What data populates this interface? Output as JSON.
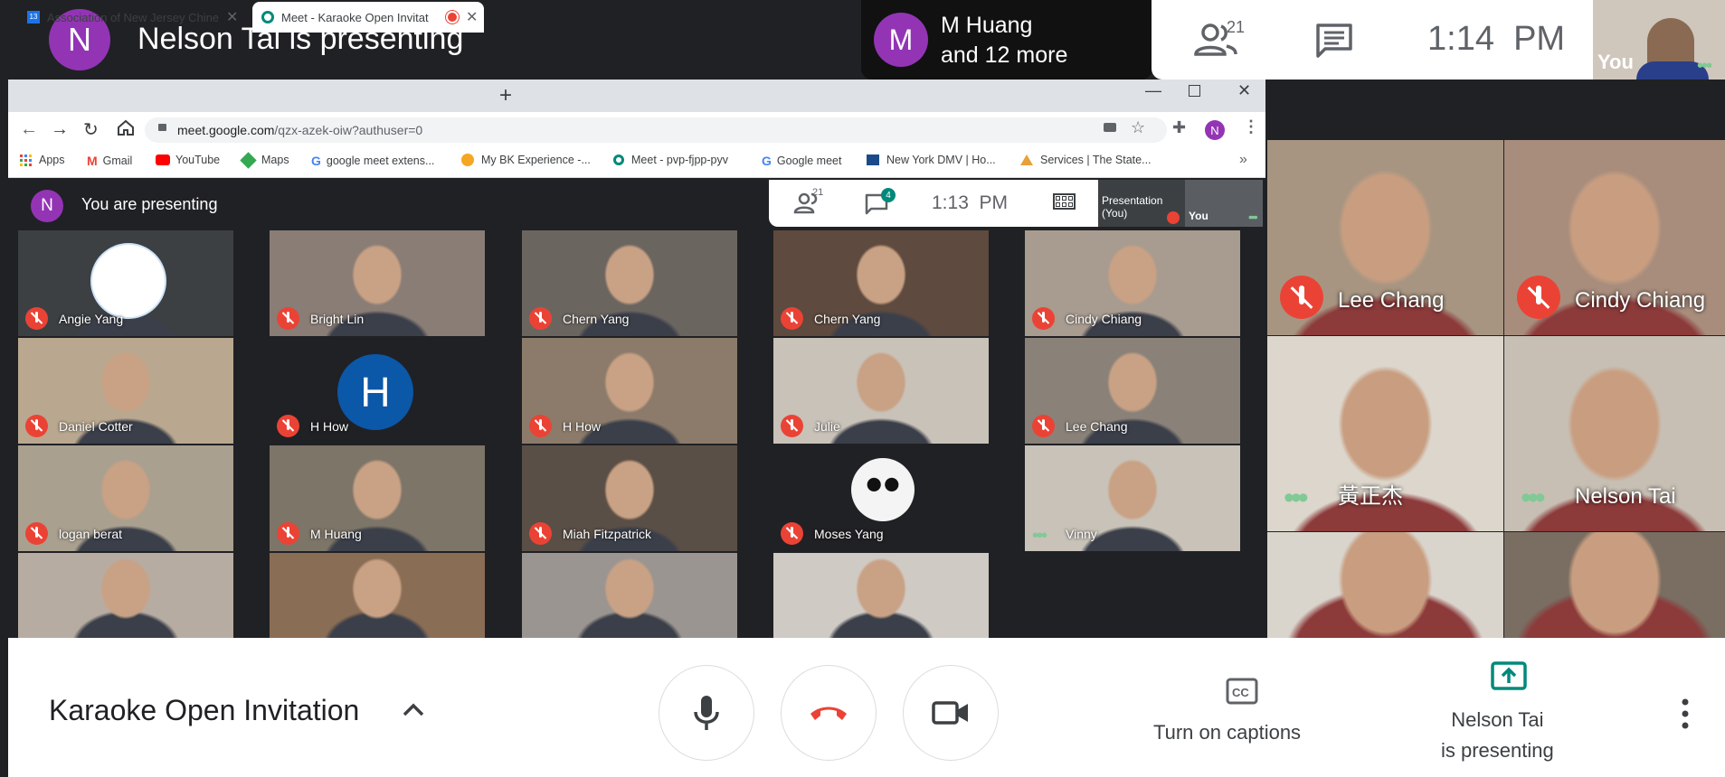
{
  "top_bar": {
    "presenter_initial": "N",
    "presenting_text": "Nelson Tai is presenting",
    "others_initial": "M",
    "others_line1": "M Huang",
    "others_line2": "and 12 more",
    "people_count": "21",
    "clock": "1:14  PM",
    "self_label": "You"
  },
  "browser": {
    "tabs": [
      {
        "label": "Association of New Jersey Chine",
        "icon": "calendar-icon"
      },
      {
        "label": "Meet - Karaoke Open Invitat",
        "icon": "meet-icon",
        "recording": true
      }
    ],
    "url_prefix": "meet.google.com",
    "url_rest": "/qzx-azek-oiw?authuser=0",
    "profile_initial": "N",
    "bookmarks": [
      {
        "label": "Apps",
        "icon": "apps-grid-icon"
      },
      {
        "label": "Gmail",
        "icon": "gmail-icon"
      },
      {
        "label": "YouTube",
        "icon": "youtube-icon"
      },
      {
        "label": "Maps",
        "icon": "maps-icon"
      },
      {
        "label": "google meet extens...",
        "icon": "google-icon"
      },
      {
        "label": "My BK Experience -...",
        "icon": "bk-icon"
      },
      {
        "label": "Meet - pvp-fjpp-pyv",
        "icon": "meet-icon"
      },
      {
        "label": "Google meet",
        "icon": "google-icon"
      },
      {
        "label": "New York DMV | Ho...",
        "icon": "dmv-icon"
      },
      {
        "label": "Services | The State...",
        "icon": "state-icon"
      }
    ]
  },
  "inner_meet": {
    "presenter_initial": "N",
    "presenting_text": "You are presenting",
    "people_count": "21",
    "chat_badge": "4",
    "clock": "1:13  PM",
    "presentation_label_line1": "Presentation",
    "presentation_label_line2": "(You)",
    "self_label": "You",
    "tiles": [
      {
        "name": "Angie Yang",
        "bg": "#3c4043",
        "muted": true
      },
      {
        "name": "Bright Lin",
        "bg": "#8a7d76",
        "muted": true
      },
      {
        "name": "Chern Yang",
        "bg": "#6b6560",
        "muted": true
      },
      {
        "name": "Chern Yang",
        "bg": "#5e4a3e",
        "muted": true
      },
      {
        "name": "Cindy Chiang",
        "bg": "#a89b8f",
        "muted": true
      },
      {
        "name": "Daniel Cotter",
        "bg": "#b9a88f",
        "muted": true
      },
      {
        "name": "H How",
        "bg": "#202124",
        "muted": true,
        "initial": "H"
      },
      {
        "name": "H How",
        "bg": "#8c7b6a",
        "muted": true
      },
      {
        "name": "Julie",
        "bg": "#c9c2b9",
        "muted": true
      },
      {
        "name": "Lee Chang",
        "bg": "#8a8279",
        "muted": true
      },
      {
        "name": "logan berat",
        "bg": "#a9a08f",
        "muted": true
      },
      {
        "name": "M Huang",
        "bg": "#7d7568",
        "muted": true
      },
      {
        "name": "Miah Fitzpatrick",
        "bg": "#5a4f46",
        "muted": true
      },
      {
        "name": "Moses Yang",
        "bg": "#202124",
        "muted": true
      },
      {
        "name": "Vinny",
        "bg": "#c8c2b8",
        "muted": false
      },
      {
        "name": "",
        "bg": "#b7aca1",
        "muted": false
      },
      {
        "name": "",
        "bg": "#8a6d55",
        "muted": false
      },
      {
        "name": "",
        "bg": "#9a9590",
        "muted": false
      },
      {
        "name": "",
        "bg": "#cfcac3",
        "muted": false
      }
    ]
  },
  "right_grid": [
    {
      "name": "Lee Chang",
      "bg": "#a79582",
      "muted": true
    },
    {
      "name": "Cindy Chiang",
      "bg": "#a88d7d",
      "muted": true
    },
    {
      "name": "黃正杰",
      "bg": "#dcd6cc",
      "muted": false
    },
    {
      "name": "Nelson Tai",
      "bg": "#c7bfb4",
      "muted": false
    },
    {
      "name": "",
      "bg": "#d9d4cc",
      "muted": false
    },
    {
      "name": "",
      "bg": "#7a6d62",
      "muted": false
    }
  ],
  "bottom_bar": {
    "meeting_title": "Karaoke Open Invitation",
    "captions_label": "Turn on captions",
    "present_line1": "Nelson Tai",
    "present_line2": "is presenting"
  },
  "colors": {
    "accent_purple": "#9334b5",
    "end_call_red": "#ea4335",
    "meet_green": "#00897b",
    "active_dots": "#81c995"
  }
}
